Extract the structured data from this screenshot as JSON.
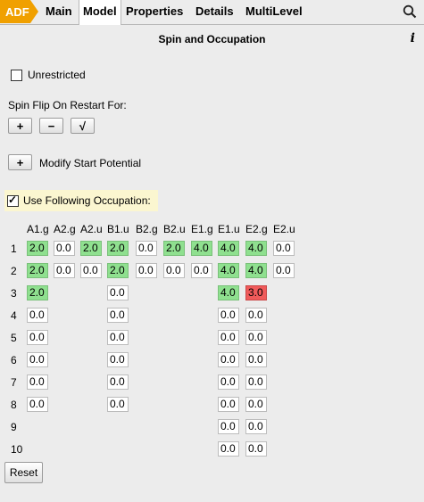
{
  "tabs": [
    "ADF",
    "Main",
    "Model",
    "Properties",
    "Details",
    "MultiLevel"
  ],
  "active_tab": "Model",
  "title": "Spin and Occupation",
  "info_glyph": "i",
  "unrestricted_label": "Unrestricted",
  "spin_flip_label": "Spin Flip On Restart For:",
  "spin_buttons": [
    "+",
    "−",
    "√"
  ],
  "modify_button": "+",
  "modify_label": "Modify Start Potential",
  "use_occ_label": "Use Following Occupation:",
  "columns": [
    "A1.g",
    "A2.g",
    "A2.u",
    "B1.u",
    "B2.g",
    "B2.u",
    "E1.g",
    "E1.u",
    "E2.g",
    "E2.u"
  ],
  "rows": [
    "1",
    "2",
    "3",
    "4",
    "5",
    "6",
    "7",
    "8",
    "9",
    "10"
  ],
  "reset_label": "Reset",
  "colors": {
    "filled": "#8fe08f",
    "error": "#f05a5a",
    "adf_tab": "#f0a000"
  },
  "occupation": [
    [
      [
        "2.0",
        "g"
      ],
      [
        "0.0",
        ""
      ],
      [
        "2.0",
        "g"
      ],
      [
        "2.0",
        "g"
      ],
      [
        "0.0",
        ""
      ],
      [
        "2.0",
        "g"
      ],
      [
        "4.0",
        "g"
      ],
      [
        "4.0",
        "g"
      ],
      [
        "4.0",
        "g"
      ],
      [
        "0.0",
        ""
      ]
    ],
    [
      [
        "2.0",
        "g"
      ],
      [
        "0.0",
        ""
      ],
      [
        "0.0",
        ""
      ],
      [
        "2.0",
        "g"
      ],
      [
        "0.0",
        ""
      ],
      [
        "0.0",
        ""
      ],
      [
        "0.0",
        ""
      ],
      [
        "4.0",
        "g"
      ],
      [
        "4.0",
        "g"
      ],
      [
        "0.0",
        ""
      ]
    ],
    [
      [
        "2.0",
        "g"
      ],
      null,
      null,
      [
        "0.0",
        ""
      ],
      null,
      null,
      null,
      [
        "4.0",
        "g"
      ],
      [
        "3.0",
        "r"
      ],
      null
    ],
    [
      [
        "0.0",
        ""
      ],
      null,
      null,
      [
        "0.0",
        ""
      ],
      null,
      null,
      null,
      [
        "0.0",
        ""
      ],
      [
        "0.0",
        ""
      ],
      null
    ],
    [
      [
        "0.0",
        ""
      ],
      null,
      null,
      [
        "0.0",
        ""
      ],
      null,
      null,
      null,
      [
        "0.0",
        ""
      ],
      [
        "0.0",
        ""
      ],
      null
    ],
    [
      [
        "0.0",
        ""
      ],
      null,
      null,
      [
        "0.0",
        ""
      ],
      null,
      null,
      null,
      [
        "0.0",
        ""
      ],
      [
        "0.0",
        ""
      ],
      null
    ],
    [
      [
        "0.0",
        ""
      ],
      null,
      null,
      [
        "0.0",
        ""
      ],
      null,
      null,
      null,
      [
        "0.0",
        ""
      ],
      [
        "0.0",
        ""
      ],
      null
    ],
    [
      [
        "0.0",
        ""
      ],
      null,
      null,
      [
        "0.0",
        ""
      ],
      null,
      null,
      null,
      [
        "0.0",
        ""
      ],
      [
        "0.0",
        ""
      ],
      null
    ],
    [
      null,
      null,
      null,
      null,
      null,
      null,
      null,
      [
        "0.0",
        ""
      ],
      [
        "0.0",
        ""
      ],
      null
    ],
    [
      null,
      null,
      null,
      null,
      null,
      null,
      null,
      [
        "0.0",
        ""
      ],
      [
        "0.0",
        ""
      ],
      null
    ]
  ]
}
